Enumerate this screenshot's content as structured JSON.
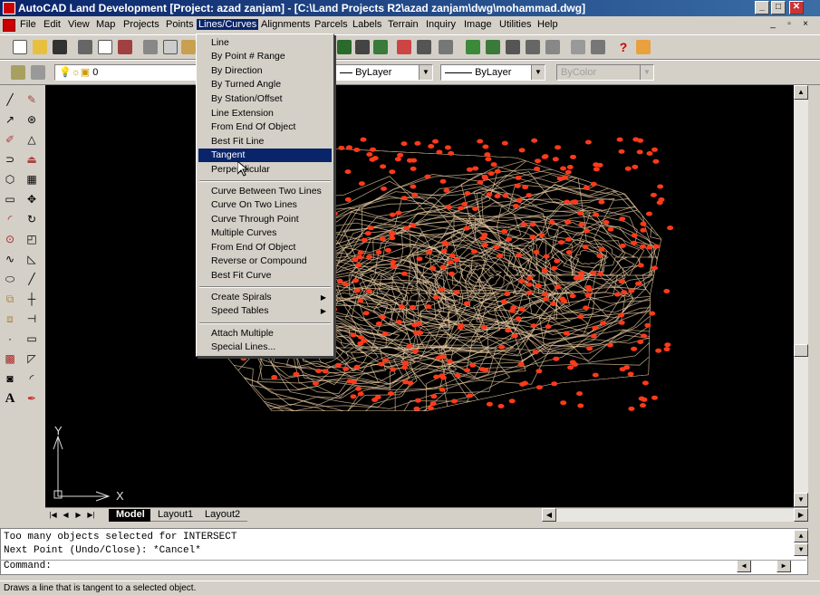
{
  "window": {
    "title": "AutoCAD Land Development [Project: azad zanjam] - [C:\\Land Projects R2\\azad zanjam\\dwg\\mohammad.dwg]",
    "controls": [
      "_",
      "□",
      "✕"
    ]
  },
  "menubar": {
    "items": [
      "File",
      "Edit",
      "View",
      "Map",
      "Projects",
      "Points",
      "Lines/Curves",
      "Alignments",
      "Parcels",
      "Labels",
      "Terrain",
      "Inquiry",
      "Image",
      "Utilities",
      "Help"
    ],
    "active": "Lines/Curves",
    "mdi_controls": [
      "_",
      "▫",
      "×"
    ]
  },
  "properties_toolbar": {
    "layer_value": "0",
    "linetype_value": "ByLayer",
    "lineweight_value": "ByLayer",
    "color_value": "ByColor"
  },
  "dropdown": {
    "groups": [
      [
        "Line",
        "By Point # Range",
        "By Direction",
        "By Turned Angle",
        "By Station/Offset",
        "Line Extension",
        "From End Of Object",
        "Best Fit Line",
        "Tangent",
        "Perpendicular"
      ],
      [
        "Curve Between Two Lines",
        "Curve On Two Lines",
        "Curve Through Point",
        "Multiple Curves",
        "From End Of Object",
        "Reverse or Compound",
        "Best Fit Curve"
      ],
      [
        "Create Spirals",
        "Speed Tables"
      ],
      [
        "Attach Multiple",
        "Special Lines..."
      ]
    ],
    "highlighted": "Tangent",
    "submenu_items": [
      "Create Spirals",
      "Speed Tables"
    ]
  },
  "ucs": {
    "x_label": "X",
    "y_label": "Y"
  },
  "tabs": {
    "items": [
      "Model",
      "Layout1",
      "Layout2"
    ],
    "active": "Model"
  },
  "command": {
    "history": [
      "Too many objects selected for INTERSECT",
      "Next Point (Undo/Close): *Cancel*"
    ],
    "prompt": "Command:"
  },
  "status": {
    "text": "Draws a line that is tangent to a selected object."
  },
  "colors": {
    "title_bar": "#0a246a",
    "highlight": "#0a246a",
    "canvas": "#000000",
    "contour": "#e8c9a0",
    "points": "#ff3a1a"
  }
}
